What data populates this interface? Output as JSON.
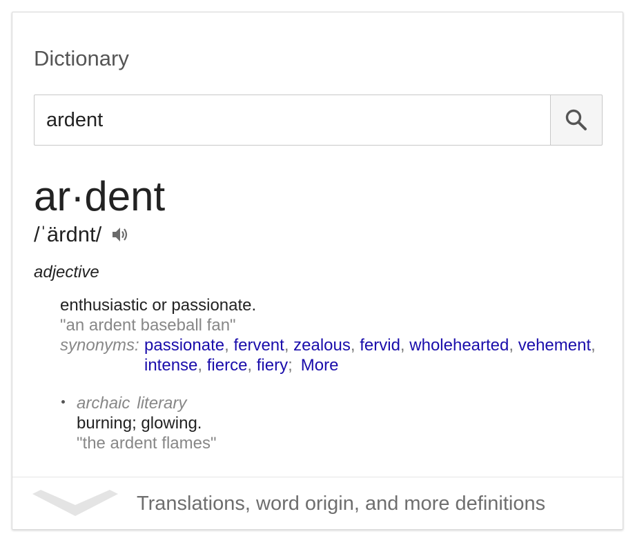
{
  "card": {
    "title": "Dictionary",
    "search": {
      "value": "ardent",
      "button_icon": "search-icon"
    }
  },
  "entry": {
    "headword": "ar·dent",
    "phonetic": "/ˈärdnt/",
    "audio_icon": "speaker-icon",
    "part_of_speech": "adjective",
    "sense1": {
      "gloss": "enthusiastic or passionate.",
      "example": "\"an ardent baseball fan\"",
      "synonyms_label": "synonyms:",
      "synonyms": [
        "passionate",
        "fervent",
        "zealous",
        "fervid",
        "wholehearted",
        "vehement",
        "intense",
        "fierce",
        "fiery"
      ],
      "more_label": "More"
    },
    "sense2": {
      "register1": "archaic",
      "register2": "literary",
      "gloss": "burning; glowing.",
      "example": "\"the ardent flames\""
    }
  },
  "footer": {
    "label": "Translations, word origin, and more definitions",
    "icon": "chevron-down-icon"
  },
  "colors": {
    "link": "#1a0dab",
    "muted": "#878787",
    "text": "#222222"
  }
}
